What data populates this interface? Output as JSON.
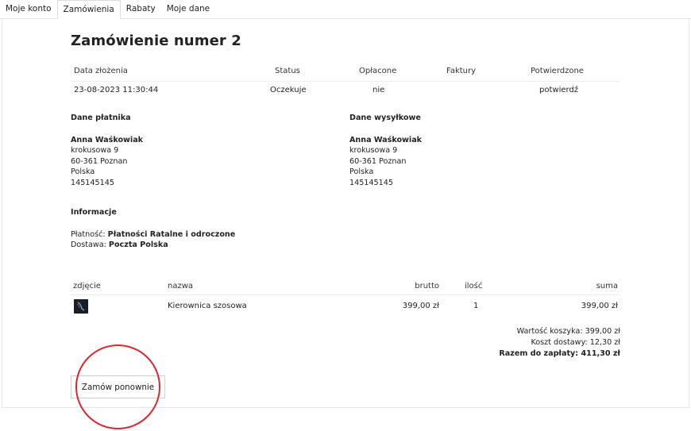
{
  "tabs": [
    "Moje konto",
    "Zamówienia",
    "Rabaty",
    "Moje dane"
  ],
  "order": {
    "title": "Zamówienie numer 2",
    "headers": {
      "date": "Data złożenia",
      "status": "Status",
      "paid": "Opłacone",
      "invoices": "Faktury",
      "confirmed": "Potwierdzone"
    },
    "values": {
      "date": "23-08-2023 11:30:44",
      "status": "Oczekuje",
      "paid": "nie",
      "invoices": "",
      "confirm_link": "potwierdź"
    }
  },
  "payer": {
    "heading": "Dane płatnika",
    "name": "Anna Waśkowiak",
    "street": "krokusowa 9",
    "city": "60-361 Poznan",
    "country": "Polska",
    "phone": "145145145"
  },
  "shipping": {
    "heading": "Dane wysyłkowe",
    "name": "Anna Waśkowiak",
    "street": "krokusowa 9",
    "city": "60-361 Poznan",
    "country": "Polska",
    "phone": "145145145"
  },
  "info": {
    "heading": "Informacje",
    "payment_label": "Płatność:",
    "payment_value": "Płatności Ratalne i odroczone",
    "delivery_label": "Dostawa:",
    "delivery_value": "Poczta Polska"
  },
  "products": {
    "headers": {
      "image": "zdjęcie",
      "name": "nazwa",
      "gross": "brutto",
      "qty": "ilość",
      "sum": "suma"
    },
    "items": [
      {
        "name": "Kierownica szosowa",
        "gross": "399,00 zł",
        "qty": "1",
        "sum": "399,00 zł"
      }
    ]
  },
  "totals": {
    "cart": "Wartość koszyka: 399,00 zł",
    "shipping": "Koszt dostawy: 12,30 zł",
    "grand": "Razem do zapłaty: 411,30 zł"
  },
  "reorder_label": "Zamów ponownie",
  "colors": {
    "accent_green": "#3a8a2a",
    "highlight_red": "#e0262d"
  }
}
